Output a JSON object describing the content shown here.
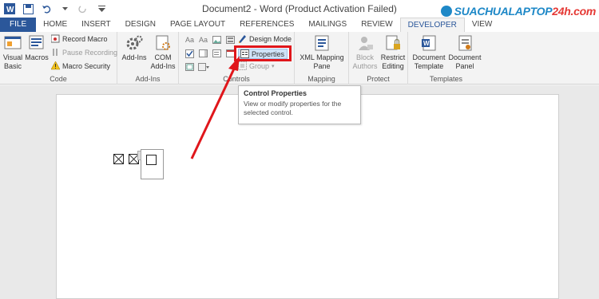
{
  "window": {
    "title": "Document2 - Word (Product Activation Failed)",
    "controls": [
      "?",
      "▢",
      "—",
      "▢",
      "✕"
    ]
  },
  "brand": {
    "part1": "SUACHUALAPTOP",
    "part2": "24h.com"
  },
  "tabs": [
    "FILE",
    "HOME",
    "INSERT",
    "DESIGN",
    "PAGE LAYOUT",
    "REFERENCES",
    "MAILINGS",
    "REVIEW",
    "DEVELOPER",
    "VIEW"
  ],
  "active_tab": "DEVELOPER",
  "ribbon": {
    "code": {
      "label": "Code",
      "visual_basic": "Visual\nBasic",
      "macros": "Macros",
      "record_macro": "Record Macro",
      "pause_recording": "Pause Recording",
      "macro_security": "Macro Security"
    },
    "addins": {
      "label": "Add-Ins",
      "add_ins": "Add-Ins",
      "com_add_ins": "COM\nAdd-Ins"
    },
    "controls": {
      "label": "Controls",
      "design_mode": "Design Mode",
      "properties": "Properties",
      "group": "Group"
    },
    "mapping": {
      "label": "Mapping",
      "xml_mapping_pane": "XML Mapping\nPane"
    },
    "protect": {
      "label": "Protect",
      "block_authors": "Block\nAuthors",
      "restrict_editing": "Restrict\nEditing"
    },
    "templates": {
      "label": "Templates",
      "document_template": "Document\nTemplate",
      "document_panel": "Document\nPanel"
    }
  },
  "tooltip": {
    "title": "Control Properties",
    "body": "View or modify properties for the selected control."
  },
  "colors": {
    "accent": "#2b579a",
    "highlight": "#e0161b"
  }
}
